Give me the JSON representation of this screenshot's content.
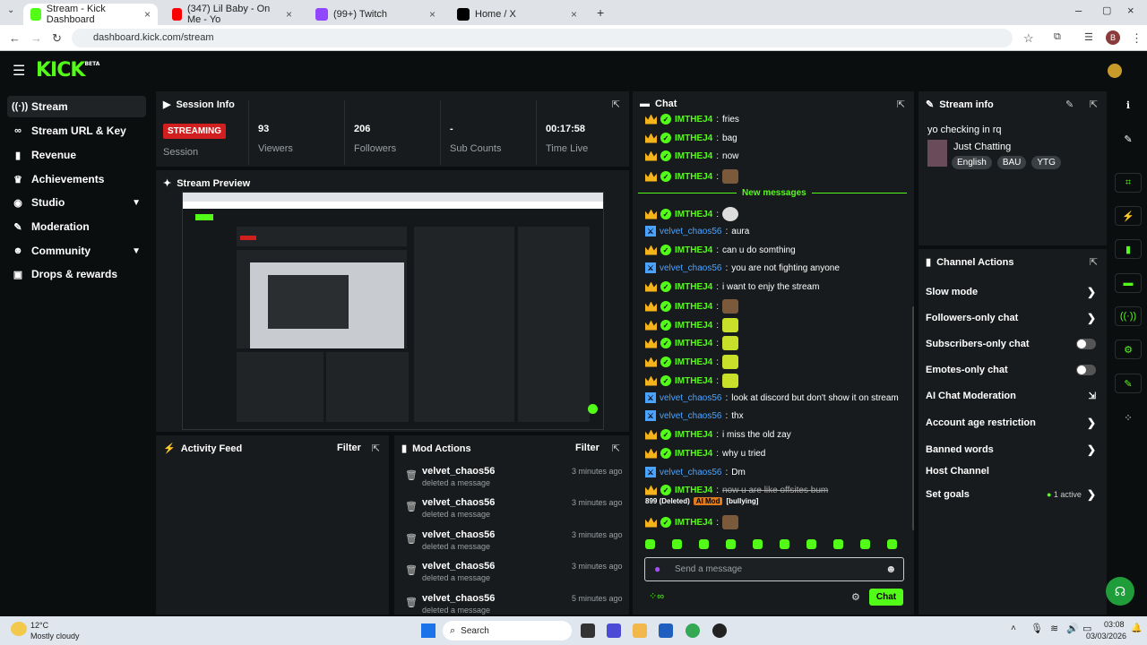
{
  "browser": {
    "tabs": [
      {
        "title": "Stream - Kick Dashboard",
        "color": "#53fc18"
      },
      {
        "title": "(347) Lil Baby - On Me - Yo",
        "color": "#ff0000"
      },
      {
        "title": "(99+) Twitch",
        "color": "#9146ff"
      },
      {
        "title": "Home / X",
        "color": "#000000"
      }
    ],
    "url": "dashboard.kick.com/stream",
    "profile_initial": "B"
  },
  "header": {
    "logo": "KICK",
    "logo_sup": "BETA"
  },
  "sidebar": {
    "items": [
      {
        "label": "Stream",
        "icon": "broadcast-icon"
      },
      {
        "label": "Stream URL & Key",
        "icon": "link-icon"
      },
      {
        "label": "Revenue",
        "icon": "chart-icon"
      },
      {
        "label": "Achievements",
        "icon": "trophy-icon"
      },
      {
        "label": "Studio",
        "icon": "studio-icon"
      },
      {
        "label": "Moderation",
        "icon": "wrench-icon"
      },
      {
        "label": "Community",
        "icon": "users-icon"
      },
      {
        "label": "Drops & rewards",
        "icon": "gift-icon"
      }
    ]
  },
  "session": {
    "title": "Session Info",
    "status": "STREAMING",
    "session_label": "Session",
    "stats": [
      {
        "value": "93",
        "label": "Viewers"
      },
      {
        "value": "206",
        "label": "Followers"
      },
      {
        "value": "-",
        "label": "Sub Counts"
      },
      {
        "value": "00:17:58",
        "label": "Time Live"
      }
    ]
  },
  "preview": {
    "title": "Stream Preview"
  },
  "activity": {
    "title": "Activity Feed",
    "filter": "Filter"
  },
  "mod_actions": {
    "title": "Mod Actions",
    "filter": "Filter",
    "rows": [
      {
        "user": "velvet_chaos56",
        "action": "deleted a message",
        "time": "3 minutes ago"
      },
      {
        "user": "velvet_chaos56",
        "action": "deleted a message",
        "time": "3 minutes ago"
      },
      {
        "user": "velvet_chaos56",
        "action": "deleted a message",
        "time": "3 minutes ago"
      },
      {
        "user": "velvet_chaos56",
        "action": "deleted a message",
        "time": "3 minutes ago"
      },
      {
        "user": "velvet_chaos56",
        "action": "deleted a message",
        "time": "5 minutes ago"
      }
    ]
  },
  "chat": {
    "title": "Chat",
    "new_messages": "New messages",
    "messages": [
      {
        "user": "IMTHEJ4",
        "text": "fries",
        "kind": "owner"
      },
      {
        "user": "IMTHEJ4",
        "text": "bag",
        "kind": "owner"
      },
      {
        "user": "IMTHEJ4",
        "text": "now",
        "kind": "owner"
      },
      {
        "user": "IMTHEJ4",
        "text": "",
        "kind": "owner",
        "emote": "face"
      },
      {
        "user": "IMTHEJ4",
        "text": "",
        "kind": "owner",
        "emote": "white"
      },
      {
        "user": "velvet_chaos56",
        "text": "aura",
        "kind": "mod"
      },
      {
        "user": "IMTHEJ4",
        "text": "can u do somthing",
        "kind": "owner"
      },
      {
        "user": "velvet_chaos56",
        "text": "you are not fighting anyone",
        "kind": "mod"
      },
      {
        "user": "IMTHEJ4",
        "text": "i want to enjy the stream",
        "kind": "owner"
      },
      {
        "user": "IMTHEJ4",
        "text": "",
        "kind": "owner",
        "emote": "face"
      },
      {
        "user": "IMTHEJ4",
        "text": "",
        "kind": "owner",
        "emote": "green"
      },
      {
        "user": "IMTHEJ4",
        "text": "",
        "kind": "owner",
        "emote": "green"
      },
      {
        "user": "IMTHEJ4",
        "text": "",
        "kind": "owner",
        "emote": "green"
      },
      {
        "user": "IMTHEJ4",
        "text": "",
        "kind": "owner",
        "emote": "green"
      },
      {
        "user": "velvet_chaos56",
        "text": "look at discord but don't show it on stream",
        "kind": "mod"
      },
      {
        "user": "velvet_chaos56",
        "text": "thx",
        "kind": "mod"
      },
      {
        "user": "IMTHEJ4",
        "text": "i miss the old zay",
        "kind": "owner"
      },
      {
        "user": "IMTHEJ4",
        "text": "why u tried",
        "kind": "owner"
      },
      {
        "user": "velvet_chaos56",
        "text": "Dm",
        "kind": "mod"
      },
      {
        "user": "IMTHEJ4",
        "text": "now u are like offsites bum",
        "kind": "deleted"
      },
      {
        "user": "IMTHEJ4",
        "text": "",
        "kind": "owner",
        "emote": "face"
      }
    ],
    "deleted_note": "899 (Deleted)",
    "ai_mod_badge": "AI Mod",
    "deleted_reason": "[bullying]",
    "input_placeholder": "Send a message",
    "send_label": "Chat"
  },
  "stream_info": {
    "title": "Stream info",
    "stream_title": "yo checking in rq",
    "category": "Just Chatting",
    "tags": [
      "English",
      "BAU",
      "YTG"
    ]
  },
  "channel_actions": {
    "title": "Channel Actions",
    "items": [
      {
        "label": "Slow mode",
        "control": "chevron"
      },
      {
        "label": "Followers-only chat",
        "control": "chevron"
      },
      {
        "label": "Subscribers-only chat",
        "control": "toggle"
      },
      {
        "label": "Emotes-only chat",
        "control": "toggle"
      },
      {
        "label": "AI Chat Moderation",
        "control": "external"
      },
      {
        "label": "Account age restriction",
        "control": "chevron"
      },
      {
        "label": "Banned words",
        "control": "chevron"
      },
      {
        "label": "Host Channel",
        "control": "none"
      },
      {
        "label": "Set goals",
        "control": "chevron"
      }
    ],
    "goals_status": "1 active"
  },
  "taskbar": {
    "weather_temp": "12°C",
    "weather_desc": "Mostly cloudy",
    "search": "Search",
    "time": "03:08",
    "date": "03/03/2026"
  },
  "colors": {
    "accent": "#53fc18",
    "live": "#d11f1f",
    "panel": "#181b1d"
  }
}
